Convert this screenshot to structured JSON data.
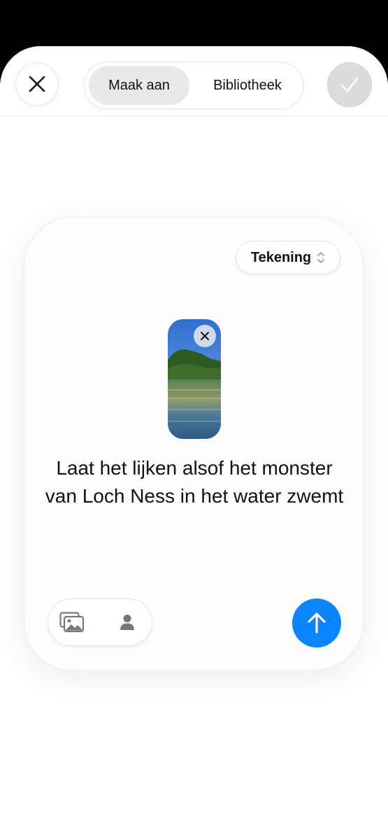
{
  "header": {
    "close_icon": "close-icon",
    "tabs": [
      {
        "label": "Maak aan",
        "active": true
      },
      {
        "label": "Bibliotheek",
        "active": false
      }
    ],
    "done_icon": "checkmark-icon"
  },
  "card": {
    "style_picker": {
      "label": "Tekening",
      "icon": "chevron-up-down-icon"
    },
    "attached_image": {
      "remove_icon": "close-icon"
    },
    "prompt": "Laat het lijken alsof het monster van Loch Ness in het water zwemt",
    "source_buttons": [
      {
        "icon": "photo-library-icon"
      },
      {
        "icon": "person-icon"
      }
    ],
    "submit_icon": "arrow-up-icon"
  },
  "colors": {
    "accent": "#0a84ff",
    "done_button": "#dcdcdc",
    "tab_active": "#e9e9e9"
  }
}
